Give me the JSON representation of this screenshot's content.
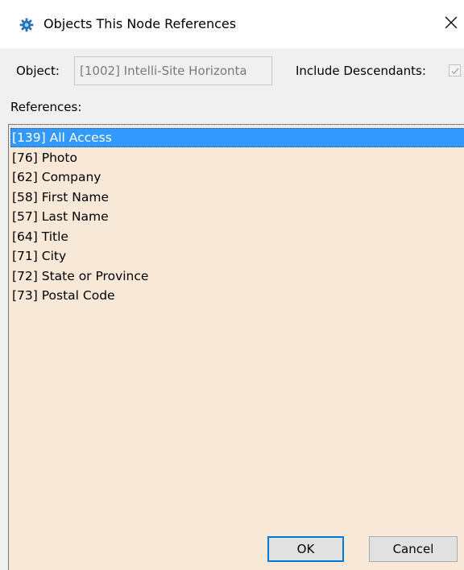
{
  "window": {
    "title": "Objects This Node References",
    "icon": "gear-icon",
    "close_glyph": "✕"
  },
  "form": {
    "object_label": "Object:",
    "object_value": "[1002] Intelli-Site Horizonta",
    "include_descendants_label": "Include Descendants:",
    "include_descendants_checked": true,
    "references_label": "References:"
  },
  "references": [
    "[139] All Access",
    "[76] Photo",
    "[62] Company",
    "[58] First Name",
    "[57] Last Name",
    "[64] Title",
    "[71] City",
    "[72] State or Province",
    "[73] Postal Code"
  ],
  "selected_index": 0,
  "buttons": {
    "ok": "OK",
    "cancel": "Cancel"
  },
  "colors": {
    "list_background": "#f8e8d8",
    "selection": "#3399ff",
    "accent": "#0078d7"
  }
}
